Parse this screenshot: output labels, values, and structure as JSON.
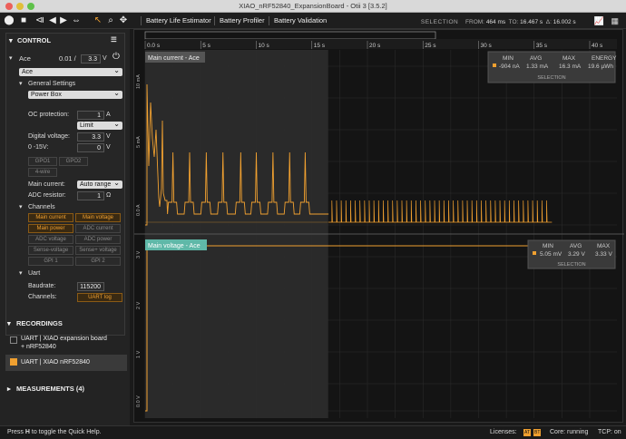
{
  "window": {
    "title": "XIAO_nRF52840_ExpansionBoard - Otii 3 [3.5.2]"
  },
  "toolbar": {
    "tabs": [
      "Battery Life Estimator",
      "Battery Profiler",
      "Battery Validation"
    ],
    "selection": {
      "label": "SELECTION",
      "from_label": "FROM:",
      "from": "464 ms",
      "to_label": "TO:",
      "to": "16.467 s",
      "delta_label": "Δ:",
      "delta": "16.002 s"
    }
  },
  "control": {
    "title": "CONTROL",
    "device": {
      "name": "Ace",
      "current_value": "0.01 /",
      "voltage_set": "3.3",
      "voltage_unit": "V"
    },
    "device_select": "Ace",
    "general_settings": "General Settings",
    "power_mode": "Power Box",
    "oc_label": "OC protection:",
    "oc_value": "1",
    "oc_unit": "A",
    "limit_mode": "Limit",
    "digital_label": "Digital voltage:",
    "digital_value": "3.3",
    "digital_unit": "V",
    "range_label": "0 -15V:",
    "range_value": "0",
    "range_unit": "V",
    "gpo1": "GPO1",
    "gpo2": "GPO2",
    "four_wire": "4-wire",
    "main_current_label": "Main current:",
    "main_current_value": "Auto range",
    "adc_label": "ADC resistor:",
    "adc_value": "1",
    "adc_unit": "Ω",
    "channels_label": "Channels",
    "channels": [
      "Main current",
      "Main voltage",
      "Main power",
      "ADC current",
      "ADC voltage",
      "ADC power",
      "Sense-voltage",
      "Sense+ voltage",
      "GPI 1",
      "GPI 2"
    ],
    "channels_on": [
      true,
      true,
      true,
      false,
      false,
      false,
      false,
      false,
      false,
      false
    ],
    "uart_label": "Uart",
    "baud_label": "Baudrate:",
    "baud_value": "115200",
    "uart_channels_label": "Channels:",
    "uart_log": "UART log"
  },
  "recordings": {
    "title": "RECORDINGS",
    "items": [
      {
        "line1": "UART | XIAO expansion board",
        "line2": "+ nRF52840"
      },
      {
        "line1": "UART | XIAO nRF52840",
        "line2": ""
      }
    ]
  },
  "measurements": {
    "title": "MEASUREMENTS (4)"
  },
  "plot": {
    "time_ticks": [
      "0.0 s",
      "5 s",
      "10 s",
      "15 s",
      "20 s",
      "25 s",
      "30 s",
      "35 s",
      "40 s"
    ],
    "current_label": "Main current - Ace",
    "current_ticks": [
      "10 mA",
      "5 mA",
      "0.0 A"
    ],
    "voltage_label": "Main voltage - Ace",
    "voltage_ticks": [
      "3 V",
      "2 V",
      "1 V",
      "0.0 V"
    ],
    "current_stats": {
      "headers": [
        "MIN",
        "AVG",
        "MAX",
        "ENERGY"
      ],
      "values": [
        "-904 nA",
        "1.33 mA",
        "16.3 mA",
        "19.6 µWh"
      ],
      "footer": "SELECTION"
    },
    "voltage_stats": {
      "headers": [
        "MIN",
        "AVG",
        "MAX"
      ],
      "values": [
        "5.05 mV",
        "3.29 V",
        "3.33 V"
      ],
      "footer": "SELECTION"
    },
    "accent": "#f0a030",
    "voltage_accent": "#5fb8a8"
  },
  "status": {
    "help": "Press",
    "help_key": "H",
    "help_rest": "to toggle the Quick Help.",
    "licenses": "Licenses:",
    "lic1": "AT",
    "lic2": "BT",
    "core": "Core: running",
    "tcp": "TCP: on"
  }
}
